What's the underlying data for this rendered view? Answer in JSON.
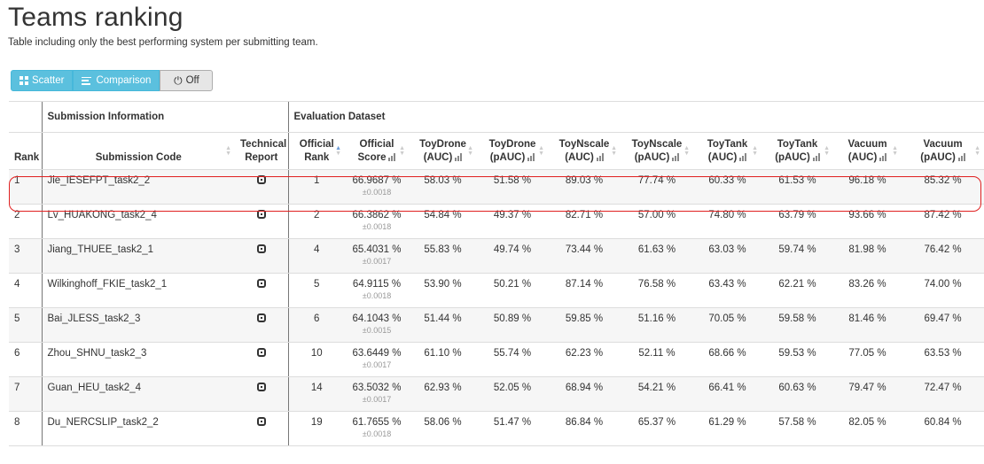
{
  "page": {
    "title": "Teams ranking",
    "subtitle": "Table including only the best performing system per submitting team."
  },
  "toolbar": {
    "scatter_label": "Scatter",
    "comparison_label": "Comparison",
    "off_label": "Off"
  },
  "table": {
    "groups": {
      "submission": "Submission Information",
      "evaluation": "Evaluation Dataset"
    },
    "columns": {
      "rank": "Rank",
      "code": "Submission Code",
      "report": [
        "Technical",
        "Report"
      ],
      "official_rank": [
        "Official",
        "Rank"
      ],
      "official_score": [
        "Official",
        "Score"
      ],
      "toydrone_auc": [
        "ToyDrone",
        "(AUC)"
      ],
      "toydrone_pauc": [
        "ToyDrone",
        "(pAUC)"
      ],
      "toynscale_auc": [
        "ToyNscale",
        "(AUC)"
      ],
      "toynscale_pauc": [
        "ToyNscale",
        "(pAUC)"
      ],
      "toytank_auc": [
        "ToyTank",
        "(AUC)"
      ],
      "toytank_pauc": [
        "ToyTank",
        "(pAUC)"
      ],
      "vacuum_auc": [
        "Vacuum",
        "(AUC)"
      ],
      "vacuum_pauc": [
        "Vacuum",
        "(pAUC)"
      ]
    },
    "rows": [
      {
        "rank": "1",
        "code": "Jie_IESEFPT_task2_2",
        "official_rank": "1",
        "score": "66.9687 %",
        "sd": "±0.0018",
        "toydrone_auc": "58.03 %",
        "toydrone_pauc": "51.58 %",
        "toynscale_auc": "89.03 %",
        "toynscale_pauc": "77.74 %",
        "toytank_auc": "60.33 %",
        "toytank_pauc": "61.53 %",
        "vacuum_auc": "96.18 %",
        "vacuum_pauc": "85.32 %"
      },
      {
        "rank": "2",
        "code": "Lv_HUAKONG_task2_4",
        "official_rank": "2",
        "score": "66.3862 %",
        "sd": "±0.0018",
        "toydrone_auc": "54.84 %",
        "toydrone_pauc": "49.37 %",
        "toynscale_auc": "82.71 %",
        "toynscale_pauc": "57.00 %",
        "toytank_auc": "74.80 %",
        "toytank_pauc": "63.79 %",
        "vacuum_auc": "93.66 %",
        "vacuum_pauc": "87.42 %"
      },
      {
        "rank": "3",
        "code": "Jiang_THUEE_task2_1",
        "official_rank": "4",
        "score": "65.4031 %",
        "sd": "±0.0017",
        "toydrone_auc": "55.83 %",
        "toydrone_pauc": "49.74 %",
        "toynscale_auc": "73.44 %",
        "toynscale_pauc": "61.63 %",
        "toytank_auc": "63.03 %",
        "toytank_pauc": "59.74 %",
        "vacuum_auc": "81.98 %",
        "vacuum_pauc": "76.42 %"
      },
      {
        "rank": "4",
        "code": "Wilkinghoff_FKIE_task2_1",
        "official_rank": "5",
        "score": "64.9115 %",
        "sd": "±0.0018",
        "toydrone_auc": "53.90 %",
        "toydrone_pauc": "50.21 %",
        "toynscale_auc": "87.14 %",
        "toynscale_pauc": "76.58 %",
        "toytank_auc": "63.43 %",
        "toytank_pauc": "62.21 %",
        "vacuum_auc": "83.26 %",
        "vacuum_pauc": "74.00 %"
      },
      {
        "rank": "5",
        "code": "Bai_JLESS_task2_3",
        "official_rank": "6",
        "score": "64.1043 %",
        "sd": "±0.0015",
        "toydrone_auc": "51.44 %",
        "toydrone_pauc": "50.89 %",
        "toynscale_auc": "59.85 %",
        "toynscale_pauc": "51.16 %",
        "toytank_auc": "70.05 %",
        "toytank_pauc": "59.58 %",
        "vacuum_auc": "81.46 %",
        "vacuum_pauc": "69.47 %"
      },
      {
        "rank": "6",
        "code": "Zhou_SHNU_task2_3",
        "official_rank": "10",
        "score": "63.6449 %",
        "sd": "±0.0017",
        "toydrone_auc": "61.10 %",
        "toydrone_pauc": "55.74 %",
        "toynscale_auc": "62.23 %",
        "toynscale_pauc": "52.11 %",
        "toytank_auc": "68.66 %",
        "toytank_pauc": "59.53 %",
        "vacuum_auc": "77.05 %",
        "vacuum_pauc": "63.53 %"
      },
      {
        "rank": "7",
        "code": "Guan_HEU_task2_4",
        "official_rank": "14",
        "score": "63.5032 %",
        "sd": "±0.0017",
        "toydrone_auc": "62.93 %",
        "toydrone_pauc": "52.05 %",
        "toynscale_auc": "68.94 %",
        "toynscale_pauc": "54.21 %",
        "toytank_auc": "66.41 %",
        "toytank_pauc": "60.63 %",
        "vacuum_auc": "79.47 %",
        "vacuum_pauc": "72.47 %"
      },
      {
        "rank": "8",
        "code": "Du_NERCSLIP_task2_2",
        "official_rank": "19",
        "score": "61.7655 %",
        "sd": "±0.0018",
        "toydrone_auc": "58.06 %",
        "toydrone_pauc": "51.47 %",
        "toynscale_auc": "86.84 %",
        "toynscale_pauc": "65.37 %",
        "toytank_auc": "61.29 %",
        "toytank_pauc": "57.58 %",
        "vacuum_auc": "82.05 %",
        "vacuum_pauc": "60.84 %"
      }
    ]
  },
  "icons": {
    "scatter": "scatter-grid-icon",
    "comparison": "comparison-lines-icon",
    "off": "power-icon",
    "report": "report-icon",
    "sort": "sort-icon",
    "bar_chart": "bar-chart-icon"
  },
  "colors": {
    "info_button": "#5bc0de",
    "highlight": "#e02020",
    "row_stripe": "#f6f6f6"
  }
}
